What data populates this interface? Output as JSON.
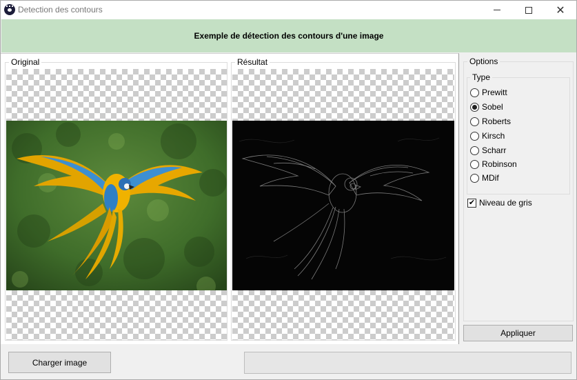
{
  "window": {
    "title": "Detection des contours",
    "controls": {
      "minimize": "minimize-icon",
      "maximize": "maximize-icon",
      "close": "close-icon"
    }
  },
  "header": {
    "text": "Exemple de détection des contours d'une image"
  },
  "panes": {
    "original_label": "Original",
    "result_label": "Résultat"
  },
  "options": {
    "group_label": "Options",
    "type_label": "Type",
    "types": [
      {
        "label": "Prewitt",
        "selected": false
      },
      {
        "label": "Sobel",
        "selected": true
      },
      {
        "label": "Roberts",
        "selected": false
      },
      {
        "label": "Kirsch",
        "selected": false
      },
      {
        "label": "Scharr",
        "selected": false
      },
      {
        "label": "Robinson",
        "selected": false
      },
      {
        "label": "MDif",
        "selected": false
      }
    ],
    "grayscale_label": "Niveau de gris",
    "grayscale_checked": true,
    "apply_label": "Appliquer"
  },
  "footer": {
    "load_label": "Charger image",
    "progress": 0
  },
  "colors": {
    "header_bg": "#c4e0c4",
    "window_bg": "#f0f0f0"
  }
}
